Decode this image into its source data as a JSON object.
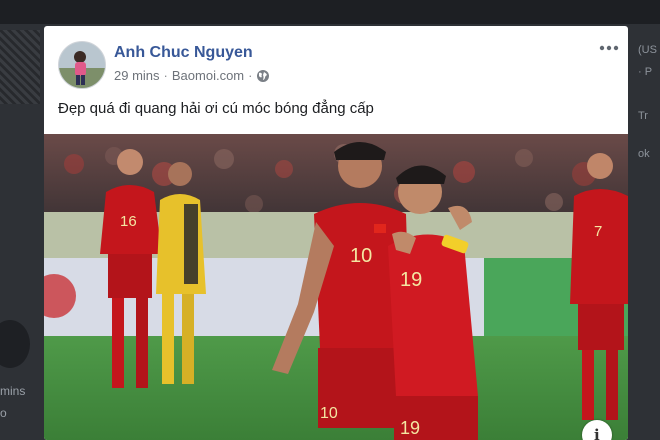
{
  "post": {
    "author": "Anh Chuc Nguyen",
    "time": "29 mins",
    "separator": "·",
    "source": "Baomoi.com",
    "text": "Đẹp quá đi quang hải ơi cú móc bóng đẳng cấp",
    "icons": {
      "privacy": "globe-icon",
      "menu": "more-icon",
      "info": "info-icon"
    }
  },
  "photo": {
    "players": [
      {
        "number": "10"
      },
      {
        "number": "19"
      },
      {
        "number": "19"
      },
      {
        "number": "16"
      },
      {
        "number": "7"
      }
    ],
    "info_label": "i"
  },
  "background": {
    "left_mins": "mins",
    "left_o": "o",
    "right_lines": [
      "(US",
      "· P",
      "Tr",
      "ok"
    ]
  },
  "colors": {
    "author_link": "#385898",
    "jersey_red": "#c4161c",
    "pitch_green": "#3f8a3c"
  }
}
